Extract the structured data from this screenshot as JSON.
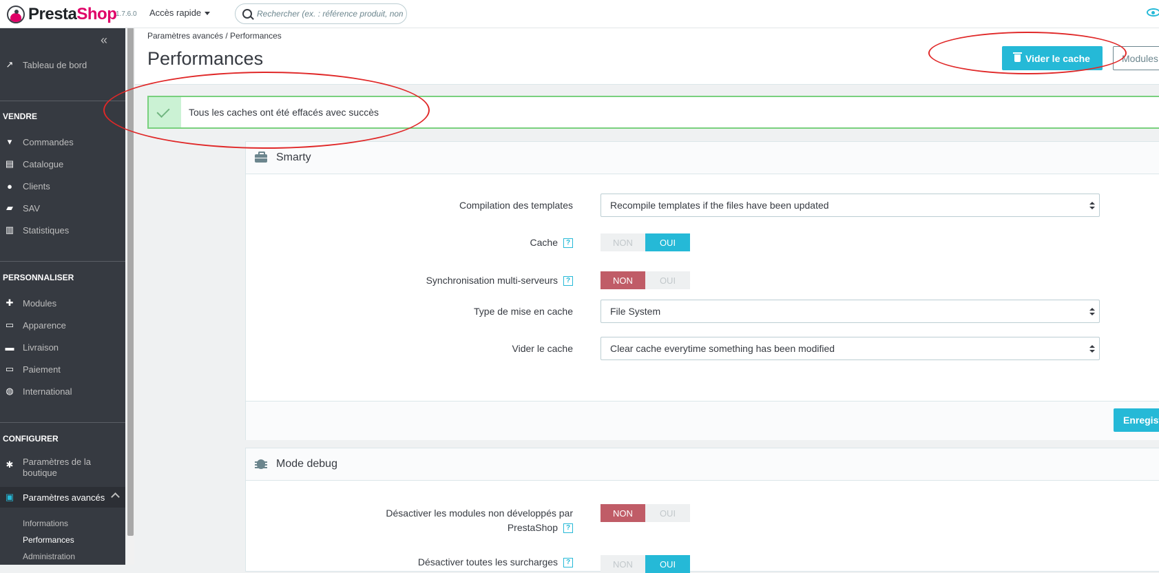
{
  "header": {
    "logo_prefix": "Presta",
    "logo_suffix": "Shop",
    "version": "1.7.6.0",
    "quick_access": "Accès rapide",
    "search_placeholder": "Rechercher (ex. : référence produit, nom"
  },
  "sidebar": {
    "dashboard": "Tableau de bord",
    "sections": {
      "sell": "VENDRE",
      "customize": "PERSONNALISER",
      "configure": "CONFIGURER"
    },
    "sell_items": [
      "Commandes",
      "Catalogue",
      "Clients",
      "SAV",
      "Statistiques"
    ],
    "customize_items": [
      "Modules",
      "Apparence",
      "Livraison",
      "Paiement",
      "International"
    ],
    "configure_items": [
      "Paramètres de la",
      "boutique",
      "Paramètres avancés"
    ],
    "sub_items": [
      "Informations",
      "Performances",
      "Administration"
    ]
  },
  "page": {
    "breadcrumb": "Paramètres avancés  /  Performances",
    "title": "Performances",
    "clear_cache_button": "Vider le cache",
    "modules_button": "Modules"
  },
  "alert": {
    "message": "Tous les caches ont été effacés avec succès"
  },
  "smarty": {
    "title": "Smarty",
    "fields": {
      "compilation_label": "Compilation des templates",
      "compilation_value": "Recompile templates if the files have been updated",
      "cache_label": "Cache",
      "sync_label": "Synchronisation multi-serveurs",
      "cache_type_label": "Type de mise en cache",
      "cache_type_value": "File System",
      "clear_label": "Vider le cache",
      "clear_value": "Clear cache everytime something has been modified"
    },
    "save_button": "Enregist"
  },
  "debug": {
    "title": "Mode debug",
    "disable_modules_label_1": "Désactiver les modules non développés par",
    "disable_modules_label_2": "PrestaShop",
    "disable_overrides_label": "Désactiver toutes les surcharges"
  },
  "switch_labels": {
    "no": "NON",
    "yes": "OUI"
  },
  "help_glyph": "?",
  "colors": {
    "accent": "#25b9d7",
    "brand": "#df0067",
    "danger": "#c05c67",
    "success_border": "#78d07d",
    "sidebar_bg": "#363a41",
    "annotation": "#e02828"
  }
}
